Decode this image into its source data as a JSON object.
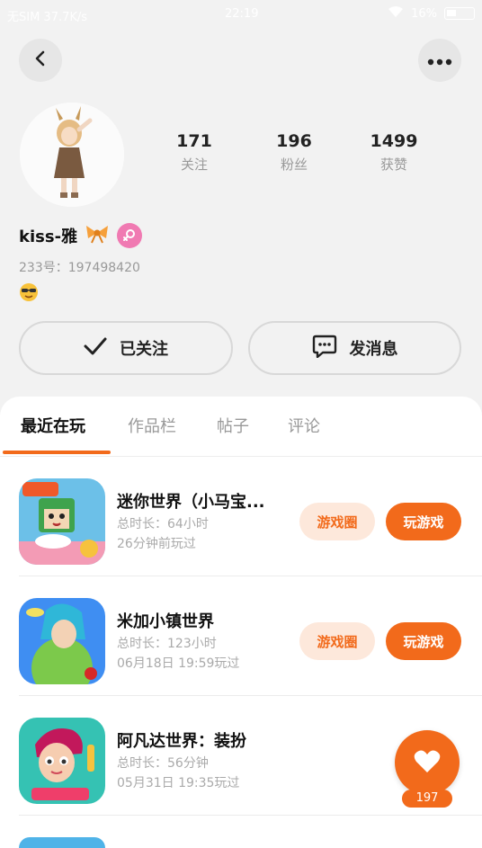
{
  "status_bar": {
    "left_text": "无SIM 37.7K/s",
    "time": "22:19",
    "battery": "16%"
  },
  "profile": {
    "username": "kiss-雅",
    "uid": "233号：197498420",
    "stats": [
      {
        "value": "171",
        "label": "关注"
      },
      {
        "value": "196",
        "label": "粉丝"
      },
      {
        "value": "1499",
        "label": "获赞"
      }
    ]
  },
  "actions": {
    "follow_label": "已关注",
    "message_label": "发消息"
  },
  "tabs": [
    {
      "label": "最近在玩",
      "active": true
    },
    {
      "label": "作品栏",
      "active": false
    },
    {
      "label": "帖子",
      "active": false
    },
    {
      "label": "评论",
      "active": false
    }
  ],
  "games": [
    {
      "title": "迷你世界（小马宝...",
      "duration": "总时长：64小时",
      "last_played": "26分钟前玩过",
      "circle_label": "游戏圈",
      "play_label": "玩游戏"
    },
    {
      "title": "米加小镇世界",
      "duration": "总时长：123小时",
      "last_played": "06月18日 19:59玩过",
      "circle_label": "游戏圈",
      "play_label": "玩游戏"
    },
    {
      "title": "阿凡达世界：装扮",
      "duration": "总时长：56分钟",
      "last_played": "05月31日 19:35玩过"
    }
  ],
  "like": {
    "count": "197"
  },
  "colors": {
    "accent": "#f26a1b",
    "accent_light": "#fde8db",
    "gender_badge": "#f07ab2"
  }
}
